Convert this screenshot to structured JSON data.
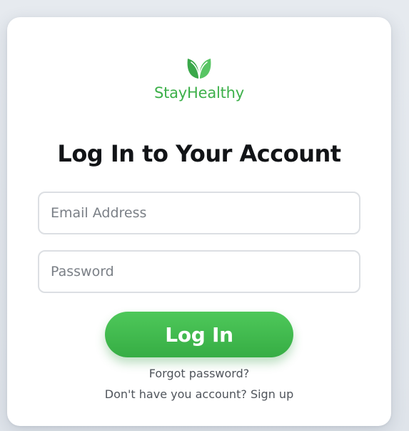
{
  "brand": {
    "name": "StayHealthy",
    "icon": "leaf-icon",
    "color": "#3db04a"
  },
  "page_title": "Log In to Your Account",
  "form": {
    "email_placeholder": "Email Address",
    "email_value": "",
    "password_placeholder": "Password",
    "password_value": ""
  },
  "login_button": {
    "label": "Log In",
    "color": "#42bb4f"
  },
  "links": {
    "forgot_password": "Forgot password?",
    "signup_prompt": "Don't have you account?",
    "signup": "Sign up"
  }
}
